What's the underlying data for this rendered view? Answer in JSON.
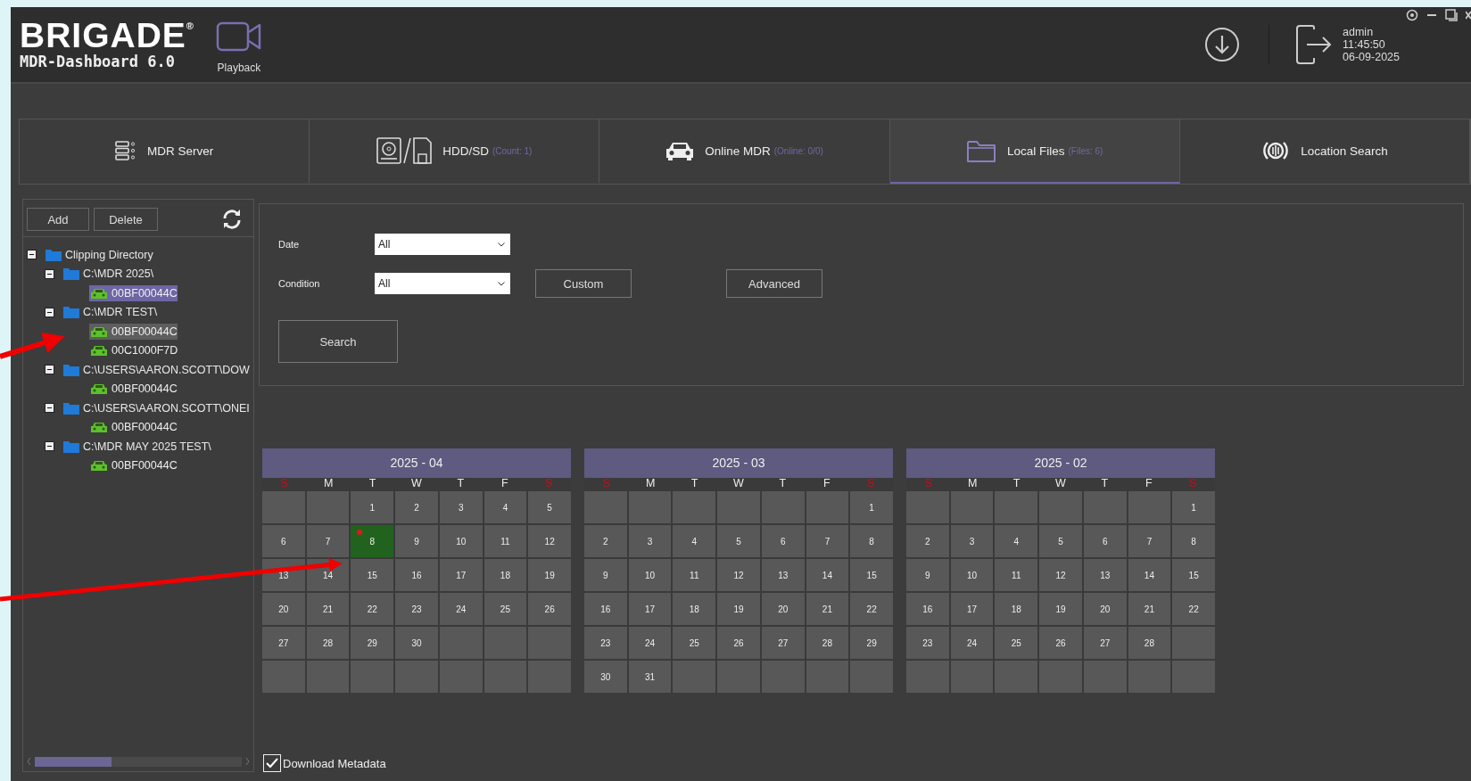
{
  "header": {
    "logo": "BRIGADE$^{®}$",
    "product": "MDR-Dashboard 6.0",
    "nav": [
      {
        "label": "Playback",
        "kind": "playback"
      }
    ],
    "user": "admin",
    "time": "11:45:50",
    "date": "06-09-2025"
  },
  "tabs": [
    {
      "label": "MDR Server",
      "kind": "server",
      "selected": false
    },
    {
      "label": "HDD/SD",
      "count": "(Count: 1)",
      "kind": "storage",
      "selected": false
    },
    {
      "label": "Online MDR",
      "count": "(Online: 0/0)",
      "kind": "car",
      "selected": false
    },
    {
      "label": "Local Files",
      "count": "(Files: 6)",
      "kind": "folder",
      "selected": true
    },
    {
      "label": "Location Search",
      "kind": "location",
      "selected": false
    }
  ],
  "sidebar": {
    "buttons": [
      "Add",
      "Delete"
    ],
    "tree": [
      {
        "label": "Clipping Directory",
        "kind": "folder",
        "expanded": true,
        "children": [
          {
            "label": "C:\\MDR 2025\\",
            "kind": "folder",
            "expanded": true,
            "children": [
              {
                "label": "00BF00044C",
                "kind": "device",
                "selected": true,
                "hovered": false
              }
            ]
          },
          {
            "label": "C:\\MDR TEST\\",
            "kind": "folder",
            "expanded": true,
            "children": [
              {
                "label": "00BF00044C",
                "kind": "device",
                "selected": false,
                "hovered": true
              },
              {
                "label": "00C1000F7D",
                "kind": "device",
                "selected": false,
                "hovered": false
              }
            ]
          },
          {
            "label": "C:\\USERS\\AARON.SCOTT\\DOW",
            "kind": "folder",
            "expanded": true,
            "children": [
              {
                "label": "00BF00044C",
                "kind": "device",
                "selected": false,
                "hovered": false
              }
            ]
          },
          {
            "label": "C:\\USERS\\AARON.SCOTT\\ONEI",
            "kind": "folder",
            "expanded": true,
            "children": [
              {
                "label": "00BF00044C",
                "kind": "device",
                "selected": false,
                "hovered": false
              }
            ]
          },
          {
            "label": "C:\\MDR MAY 2025 TEST\\",
            "kind": "folder",
            "expanded": true,
            "children": [
              {
                "label": "00BF00044C",
                "kind": "device",
                "selected": false,
                "hovered": false
              }
            ]
          }
        ]
      }
    ]
  },
  "filter": {
    "date": {
      "label": "Date",
      "value": "All"
    },
    "condition": {
      "label": "Condition",
      "value": "All"
    },
    "custom_button": "Custom",
    "advanced_button": "Advanced",
    "search_button": "Search"
  },
  "calendars": [
    {
      "title": "2025 - 04",
      "weekdays": [
        {
          "label": "S",
          "weekend": true
        },
        {
          "label": "M",
          "weekend": false
        },
        {
          "label": "T",
          "weekend": false
        },
        {
          "label": "W",
          "weekend": false
        },
        {
          "label": "T",
          "weekend": false
        },
        {
          "label": "F",
          "weekend": false
        },
        {
          "label": "S",
          "weekend": true
        }
      ],
      "cells": [
        {
          "kind": "blank"
        },
        {
          "kind": "blank"
        },
        {
          "kind": "day",
          "day": "1",
          "selected": false,
          "marked": false
        },
        {
          "kind": "day",
          "day": "2",
          "selected": false,
          "marked": false
        },
        {
          "kind": "day",
          "day": "3",
          "selected": false,
          "marked": false
        },
        {
          "kind": "day",
          "day": "4",
          "selected": false,
          "marked": false
        },
        {
          "kind": "day",
          "day": "5",
          "selected": false,
          "marked": false
        },
        {
          "kind": "day",
          "day": "6",
          "selected": false,
          "marked": false
        },
        {
          "kind": "day",
          "day": "7",
          "selected": false,
          "marked": false
        },
        {
          "kind": "day",
          "day": "8",
          "selected": true,
          "marked": true
        },
        {
          "kind": "day",
          "day": "9",
          "selected": false,
          "marked": false
        },
        {
          "kind": "day",
          "day": "10",
          "selected": false,
          "marked": false
        },
        {
          "kind": "day",
          "day": "11",
          "selected": false,
          "marked": false
        },
        {
          "kind": "day",
          "day": "12",
          "selected": false,
          "marked": false
        },
        {
          "kind": "day",
          "day": "13",
          "selected": false,
          "marked": false
        },
        {
          "kind": "day",
          "day": "14",
          "selected": false,
          "marked": false
        },
        {
          "kind": "day",
          "day": "15",
          "selected": false,
          "marked": false
        },
        {
          "kind": "day",
          "day": "16",
          "selected": false,
          "marked": false
        },
        {
          "kind": "day",
          "day": "17",
          "selected": false,
          "marked": false
        },
        {
          "kind": "day",
          "day": "18",
          "selected": false,
          "marked": false
        },
        {
          "kind": "day",
          "day": "19",
          "selected": false,
          "marked": false
        },
        {
          "kind": "day",
          "day": "20",
          "selected": false,
          "marked": false
        },
        {
          "kind": "day",
          "day": "21",
          "selected": false,
          "marked": false
        },
        {
          "kind": "day",
          "day": "22",
          "selected": false,
          "marked": false
        },
        {
          "kind": "day",
          "day": "23",
          "selected": false,
          "marked": false
        },
        {
          "kind": "day",
          "day": "24",
          "selected": false,
          "marked": false
        },
        {
          "kind": "day",
          "day": "25",
          "selected": false,
          "marked": false
        },
        {
          "kind": "day",
          "day": "26",
          "selected": false,
          "marked": false
        },
        {
          "kind": "day",
          "day": "27",
          "selected": false,
          "marked": false
        },
        {
          "kind": "day",
          "day": "28",
          "selected": false,
          "marked": false
        },
        {
          "kind": "day",
          "day": "29",
          "selected": false,
          "marked": false
        },
        {
          "kind": "day",
          "day": "30",
          "selected": false,
          "marked": false
        },
        {
          "kind": "blank"
        },
        {
          "kind": "blank"
        },
        {
          "kind": "blank"
        },
        {
          "kind": "blank"
        },
        {
          "kind": "blank"
        },
        {
          "kind": "blank"
        },
        {
          "kind": "blank"
        },
        {
          "kind": "blank"
        },
        {
          "kind": "blank"
        },
        {
          "kind": "blank"
        }
      ]
    },
    {
      "title": "2025 - 03",
      "weekdays": [
        {
          "label": "S",
          "weekend": true
        },
        {
          "label": "M",
          "weekend": false
        },
        {
          "label": "T",
          "weekend": false
        },
        {
          "label": "W",
          "weekend": false
        },
        {
          "label": "T",
          "weekend": false
        },
        {
          "label": "F",
          "weekend": false
        },
        {
          "label": "S",
          "weekend": true
        }
      ],
      "cells": [
        {
          "kind": "blank"
        },
        {
          "kind": "blank"
        },
        {
          "kind": "blank"
        },
        {
          "kind": "blank"
        },
        {
          "kind": "blank"
        },
        {
          "kind": "blank"
        },
        {
          "kind": "day",
          "day": "1",
          "selected": false,
          "marked": false
        },
        {
          "kind": "day",
          "day": "2",
          "selected": false,
          "marked": false
        },
        {
          "kind": "day",
          "day": "3",
          "selected": false,
          "marked": false
        },
        {
          "kind": "day",
          "day": "4",
          "selected": false,
          "marked": false
        },
        {
          "kind": "day",
          "day": "5",
          "selected": false,
          "marked": false
        },
        {
          "kind": "day",
          "day": "6",
          "selected": false,
          "marked": false
        },
        {
          "kind": "day",
          "day": "7",
          "selected": false,
          "marked": false
        },
        {
          "kind": "day",
          "day": "8",
          "selected": false,
          "marked": false
        },
        {
          "kind": "day",
          "day": "9",
          "selected": false,
          "marked": false
        },
        {
          "kind": "day",
          "day": "10",
          "selected": false,
          "marked": false
        },
        {
          "kind": "day",
          "day": "11",
          "selected": false,
          "marked": false
        },
        {
          "kind": "day",
          "day": "12",
          "selected": false,
          "marked": false
        },
        {
          "kind": "day",
          "day": "13",
          "selected": false,
          "marked": false
        },
        {
          "kind": "day",
          "day": "14",
          "selected": false,
          "marked": false
        },
        {
          "kind": "day",
          "day": "15",
          "selected": false,
          "marked": false
        },
        {
          "kind": "day",
          "day": "16",
          "selected": false,
          "marked": false
        },
        {
          "kind": "day",
          "day": "17",
          "selected": false,
          "marked": false
        },
        {
          "kind": "day",
          "day": "18",
          "selected": false,
          "marked": false
        },
        {
          "kind": "day",
          "day": "19",
          "selected": false,
          "marked": false
        },
        {
          "kind": "day",
          "day": "20",
          "selected": false,
          "marked": false
        },
        {
          "kind": "day",
          "day": "21",
          "selected": false,
          "marked": false
        },
        {
          "kind": "day",
          "day": "22",
          "selected": false,
          "marked": false
        },
        {
          "kind": "day",
          "day": "23",
          "selected": false,
          "marked": false
        },
        {
          "kind": "day",
          "day": "24",
          "selected": false,
          "marked": false
        },
        {
          "kind": "day",
          "day": "25",
          "selected": false,
          "marked": false
        },
        {
          "kind": "day",
          "day": "26",
          "selected": false,
          "marked": false
        },
        {
          "kind": "day",
          "day": "27",
          "selected": false,
          "marked": false
        },
        {
          "kind": "day",
          "day": "28",
          "selected": false,
          "marked": false
        },
        {
          "kind": "day",
          "day": "29",
          "selected": false,
          "marked": false
        },
        {
          "kind": "day",
          "day": "30",
          "selected": false,
          "marked": false
        },
        {
          "kind": "day",
          "day": "31",
          "selected": false,
          "marked": false
        },
        {
          "kind": "blank"
        },
        {
          "kind": "blank"
        },
        {
          "kind": "blank"
        },
        {
          "kind": "blank"
        },
        {
          "kind": "blank"
        }
      ]
    },
    {
      "title": "2025 - 02",
      "weekdays": [
        {
          "label": "S",
          "weekend": true
        },
        {
          "label": "M",
          "weekend": false
        },
        {
          "label": "T",
          "weekend": false
        },
        {
          "label": "W",
          "weekend": false
        },
        {
          "label": "T",
          "weekend": false
        },
        {
          "label": "F",
          "weekend": false
        },
        {
          "label": "S",
          "weekend": true
        }
      ],
      "cells": [
        {
          "kind": "blank"
        },
        {
          "kind": "blank"
        },
        {
          "kind": "blank"
        },
        {
          "kind": "blank"
        },
        {
          "kind": "blank"
        },
        {
          "kind": "blank"
        },
        {
          "kind": "day",
          "day": "1",
          "selected": false,
          "marked": false
        },
        {
          "kind": "day",
          "day": "2",
          "selected": false,
          "marked": false
        },
        {
          "kind": "day",
          "day": "3",
          "selected": false,
          "marked": false
        },
        {
          "kind": "day",
          "day": "4",
          "selected": false,
          "marked": false
        },
        {
          "kind": "day",
          "day": "5",
          "selected": false,
          "marked": false
        },
        {
          "kind": "day",
          "day": "6",
          "selected": false,
          "marked": false
        },
        {
          "kind": "day",
          "day": "7",
          "selected": false,
          "marked": false
        },
        {
          "kind": "day",
          "day": "8",
          "selected": false,
          "marked": false
        },
        {
          "kind": "day",
          "day": "9",
          "selected": false,
          "marked": false
        },
        {
          "kind": "day",
          "day": "10",
          "selected": false,
          "marked": false
        },
        {
          "kind": "day",
          "day": "11",
          "selected": false,
          "marked": false
        },
        {
          "kind": "day",
          "day": "12",
          "selected": false,
          "marked": false
        },
        {
          "kind": "day",
          "day": "13",
          "selected": false,
          "marked": false
        },
        {
          "kind": "day",
          "day": "14",
          "selected": false,
          "marked": false
        },
        {
          "kind": "day",
          "day": "15",
          "selected": false,
          "marked": false
        },
        {
          "kind": "day",
          "day": "16",
          "selected": false,
          "marked": false
        },
        {
          "kind": "day",
          "day": "17",
          "selected": false,
          "marked": false
        },
        {
          "kind": "day",
          "day": "18",
          "selected": false,
          "marked": false
        },
        {
          "kind": "day",
          "day": "19",
          "selected": false,
          "marked": false
        },
        {
          "kind": "day",
          "day": "20",
          "selected": false,
          "marked": false
        },
        {
          "kind": "day",
          "day": "21",
          "selected": false,
          "marked": false
        },
        {
          "kind": "day",
          "day": "22",
          "selected": false,
          "marked": false
        },
        {
          "kind": "day",
          "day": "23",
          "selected": false,
          "marked": false
        },
        {
          "kind": "day",
          "day": "24",
          "selected": false,
          "marked": false
        },
        {
          "kind": "day",
          "day": "25",
          "selected": false,
          "marked": false
        },
        {
          "kind": "day",
          "day": "26",
          "selected": false,
          "marked": false
        },
        {
          "kind": "day",
          "day": "27",
          "selected": false,
          "marked": false
        },
        {
          "kind": "day",
          "day": "28",
          "selected": false,
          "marked": false
        },
        {
          "kind": "blank"
        },
        {
          "kind": "blank"
        },
        {
          "kind": "blank"
        },
        {
          "kind": "blank"
        },
        {
          "kind": "blank"
        },
        {
          "kind": "blank"
        },
        {
          "kind": "blank"
        },
        {
          "kind": "blank"
        }
      ]
    }
  ],
  "download_metadata": {
    "label": "Download Metadata",
    "checked": true
  }
}
